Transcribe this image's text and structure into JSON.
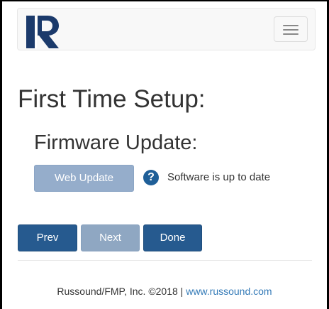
{
  "header": {
    "logo_letter": "R",
    "menu_icon": "hamburger-menu-icon"
  },
  "page": {
    "title": "First Time Setup:"
  },
  "firmware": {
    "title": "Firmware Update:",
    "web_update_label": "Web Update",
    "help_icon_glyph": "?",
    "status": "Software is up to date"
  },
  "nav": {
    "prev_label": "Prev",
    "next_label": "Next",
    "done_label": "Done"
  },
  "footer": {
    "copyright": "Russound/FMP, Inc. ©2018",
    "separator": "|",
    "link_text": "www.russound.com"
  },
  "colors": {
    "primary": "#265a8f",
    "disabled": "#8fa7c2",
    "link": "#337ab7",
    "logo": "#1b3a6b"
  }
}
